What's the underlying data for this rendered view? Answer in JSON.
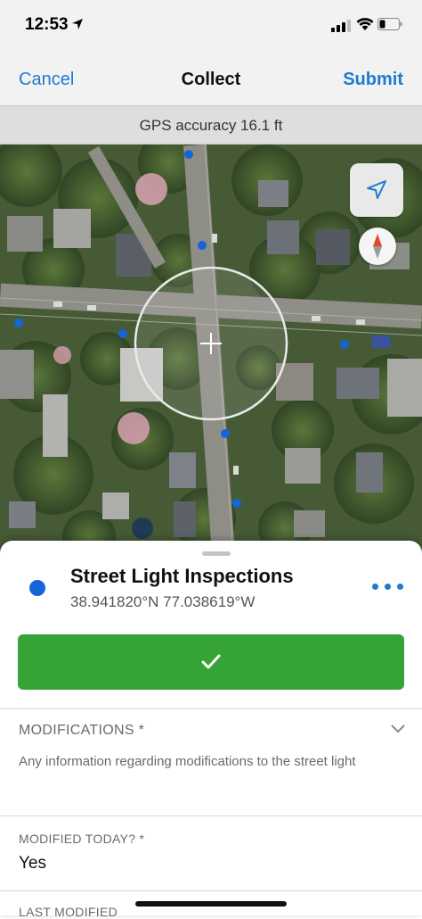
{
  "status_bar": {
    "time": "12:53"
  },
  "nav": {
    "cancel": "Cancel",
    "title": "Collect",
    "submit": "Submit"
  },
  "gps": {
    "accuracy_text": "GPS accuracy 16.1 ft"
  },
  "map": {
    "icons": {
      "locate": "navigation-arrow-icon",
      "compass": "compass-icon",
      "crosshair": "crosshair-icon"
    },
    "point_color": "#1565d8"
  },
  "sheet": {
    "layer_name": "Street Light Inspections",
    "coordinates": "38.941820°N  77.038619°W",
    "layer_color": "#1565d8",
    "confirm_color": "#35a336"
  },
  "form": {
    "modifications": {
      "label": "MODIFICATIONS *",
      "description": "Any information regarding modifications to the street light"
    },
    "modified_today": {
      "label": "MODIFIED TODAY? *",
      "value": "Yes"
    },
    "last_modified": {
      "label": "LAST MODIFIED"
    }
  },
  "colors": {
    "accent": "#1f7ad1"
  }
}
